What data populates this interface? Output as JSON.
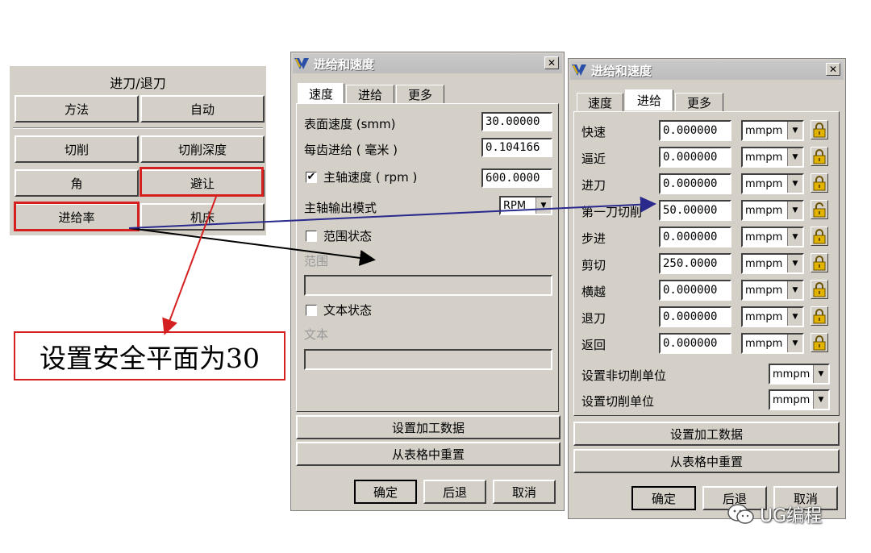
{
  "menu": {
    "title": "进刀/退刀",
    "buttons": [
      "方法",
      "自动",
      "切削",
      "切削深度",
      "角",
      "避让",
      "进给率",
      "机床"
    ]
  },
  "annotation": {
    "text": "设置安全平面为30"
  },
  "dialog1": {
    "title": "进给和速度",
    "tabs": [
      "速度",
      "进给",
      "更多"
    ],
    "surface_speed_label": "表面速度 (smm)",
    "surface_speed_value": "30.00000",
    "feed_per_tooth_label": "每齿进给 ( 毫米 )",
    "feed_per_tooth_value": "0.104166",
    "spindle_speed_label": "主轴速度 ( rpm )",
    "spindle_speed_value": "600.0000",
    "spindle_mode_label": "主轴输出模式",
    "spindle_mode_value": "RPM",
    "range_state_label": "范围状态",
    "range_label": "范围",
    "text_state_label": "文本状态",
    "text_label": "文本",
    "set_data_button": "设置加工数据",
    "reset_button": "从表格中重置",
    "ok_button": "确定",
    "back_button": "后退",
    "cancel_button": "取消"
  },
  "dialog2": {
    "title": "进给和速度",
    "tabs": [
      "速度",
      "进给",
      "更多"
    ],
    "rows": [
      {
        "label": "快速",
        "value": "0.000000",
        "unit": "mmpm",
        "locked": true
      },
      {
        "label": "逼近",
        "value": "0.000000",
        "unit": "mmpm",
        "locked": true
      },
      {
        "label": "进刀",
        "value": "0.000000",
        "unit": "mmpm",
        "locked": true
      },
      {
        "label": "第一刀切削",
        "value": "50.00000",
        "unit": "mmpm",
        "locked": false
      },
      {
        "label": "步进",
        "value": "0.000000",
        "unit": "mmpm",
        "locked": true
      },
      {
        "label": "剪切",
        "value": "250.0000",
        "unit": "mmpm",
        "locked": true
      },
      {
        "label": "横越",
        "value": "0.000000",
        "unit": "mmpm",
        "locked": true
      },
      {
        "label": "退刀",
        "value": "0.000000",
        "unit": "mmpm",
        "locked": true
      },
      {
        "label": "返回",
        "value": "0.000000",
        "unit": "mmpm",
        "locked": true
      }
    ],
    "noncut_unit_label": "设置非切削单位",
    "noncut_unit_value": "mmpm",
    "cut_unit_label": "设置切削单位",
    "cut_unit_value": "mmpm",
    "set_data_button": "设置加工数据",
    "reset_button": "从表格中重置",
    "ok_button": "确定",
    "back_button": "后退",
    "cancel_button": "取消"
  },
  "watermark": {
    "text": "UG编程"
  },
  "colors": {
    "highlight_red": "#d42020",
    "arrow_blue": "#2a2a8c",
    "dialog_gray": "#d4d0c8"
  }
}
